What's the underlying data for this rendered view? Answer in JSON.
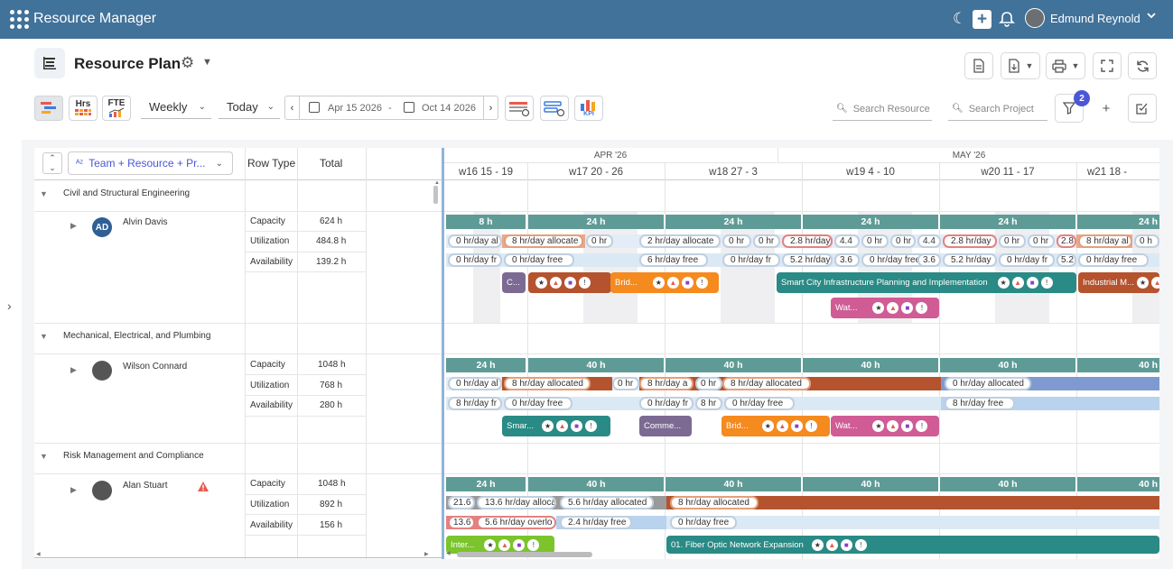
{
  "app": {
    "title": "Resource Manager",
    "user_name": "Edmund Reynold"
  },
  "page": {
    "title": "Resource Plan"
  },
  "toolbar": {
    "view_hrs": "Hrs",
    "view_fte": "FTE",
    "period": "Weekly",
    "today": "Today",
    "date_from": "Apr 15 2026",
    "date_sep": "-",
    "date_to": "Oct 14 2026",
    "kpi": "KPI",
    "search_resource_placeholder": "Search Resource",
    "search_project_placeholder": "Search Project",
    "filter_count": "2"
  },
  "grid": {
    "groupby_label": "Team + Resource + Pr...",
    "col_row_type": "Row Type",
    "col_total": "Total",
    "row_types": [
      "Capacity",
      "Utilization",
      "Availability"
    ],
    "teams": [
      {
        "name": "Civil and Structural Engineering",
        "resource": "Alvin Davis",
        "initials": "AD",
        "totals": [
          "624 h",
          "484.8 h",
          "139.2 h"
        ]
      },
      {
        "name": "Mechanical, Electrical, and Plumbing",
        "resource": "Wilson Connard",
        "totals": [
          "1048 h",
          "768 h",
          "280 h"
        ]
      },
      {
        "name": "Risk Management and Compliance",
        "resource": "Alan Stuart",
        "totals": [
          "1048 h",
          "892 h",
          "156 h"
        ]
      }
    ]
  },
  "timeline": {
    "months": [
      "APR '26",
      "MAY '26"
    ],
    "weeks": [
      "w16 15 - 19",
      "w17 20 - 26",
      "w18 27 - 3",
      "w19 4 - 10",
      "w20 11 - 17",
      "w21 18 -"
    ],
    "r1": {
      "capacity": [
        "8 h",
        "24 h",
        "24 h",
        "24 h",
        "24 h",
        "24 h"
      ],
      "util": [
        "0 hr/day al",
        "8 hr/day allocate",
        "0 hr",
        "2 hr/day allocate",
        "0 hr",
        "0 hr",
        "2.8 hr/day",
        "4.4",
        "0 hr",
        "0 hr",
        "4.4",
        "2.8 hr/day",
        "0 hr",
        "0 hr",
        "2.8",
        "8 hr/day al",
        "0 h"
      ],
      "avail": [
        "0 hr/day fr",
        "0 hr/day free",
        "6 hr/day free",
        "0 hr/day fr",
        "5.2 hr/day",
        "3.6",
        "0 hr/day free",
        "3.6",
        "5.2 hr/day",
        "0 hr/day fr",
        "5.2",
        "0 hr/day free"
      ],
      "projects": [
        "C...",
        "Brid...",
        "Smart City Infrastructure Planning and Implementation",
        "Industrial M...",
        "Wat..."
      ]
    },
    "r2": {
      "capacity": [
        "24 h",
        "40 h",
        "40 h",
        "40 h",
        "40 h",
        "40 h"
      ],
      "util": [
        "0 hr/day al",
        "8 hr/day allocated",
        "0 hr",
        "8 hr/day a",
        "0 hr",
        "8 hr/day allocated",
        "0 hr/day allocated"
      ],
      "avail": [
        "8 hr/day fr",
        "0 hr/day free",
        "0 hr/day fr",
        "8 hr",
        "0 hr/day free",
        "8 hr/day free"
      ],
      "projects": [
        "Smar...",
        "Comme...",
        "Brid...",
        "Wat..."
      ]
    },
    "r3": {
      "capacity": [
        "24 h",
        "40 h",
        "40 h",
        "40 h",
        "40 h",
        "40 h"
      ],
      "util": [
        "21.6",
        "13.6 hr/day alloca",
        "5.6 hr/day allocated",
        "8 hr/day allocated"
      ],
      "avail": [
        "13.6",
        "5.6 hr/day overlo",
        "2.4 hr/day free",
        "0 hr/day free"
      ],
      "projects": [
        "Inter...",
        "01. Fiber Optic Network Expansion"
      ]
    }
  },
  "colors": {
    "header": "#41729a",
    "capacity": "#5e9b96",
    "accent": "#4a56d6",
    "teal": "#2a8a85",
    "orange": "#f58a1f",
    "rust": "#b5532e",
    "purple": "#7c6a93",
    "pink": "#d05c95",
    "green": "#7bc42c"
  }
}
